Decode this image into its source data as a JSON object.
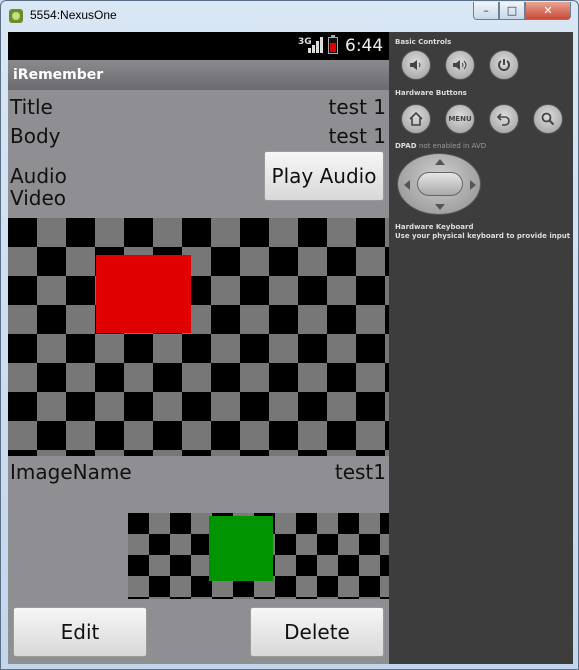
{
  "window": {
    "title": "5554:NexusOne",
    "minimize_label": "–",
    "maximize_label": "□",
    "close_label": "✕"
  },
  "status_bar": {
    "network": "3G",
    "time": "6:44"
  },
  "app": {
    "name": "iRemember",
    "title_label": "Title",
    "title_value": "test 1",
    "body_label": "Body",
    "body_value": "test 1",
    "audio_label": "Audio",
    "video_label": "Video",
    "play_audio_button": "Play Audio",
    "image_name_label": "ImageName",
    "image_name_value": "test1",
    "edit_button": "Edit",
    "delete_button": "Delete"
  },
  "emulator_panel": {
    "basic_controls_heading": "Basic Controls",
    "hardware_buttons_heading": "Hardware Buttons",
    "dpad_heading": "DPAD",
    "dpad_note": "not enabled in AVD",
    "keyboard_heading": "Hardware Keyboard",
    "keyboard_note": "Use your physical keyboard to provide input",
    "menu_label": "MENU",
    "basic_controls": [
      "volume-down-icon",
      "volume-up-icon",
      "power-icon"
    ],
    "hardware_buttons": [
      "home-icon",
      "menu-button",
      "back-icon",
      "search-icon"
    ]
  },
  "colors": {
    "screen_bg": "#8f8e93",
    "red_square": "#e00000",
    "green_square": "#009400",
    "panel_bg": "#3d3d3d"
  }
}
